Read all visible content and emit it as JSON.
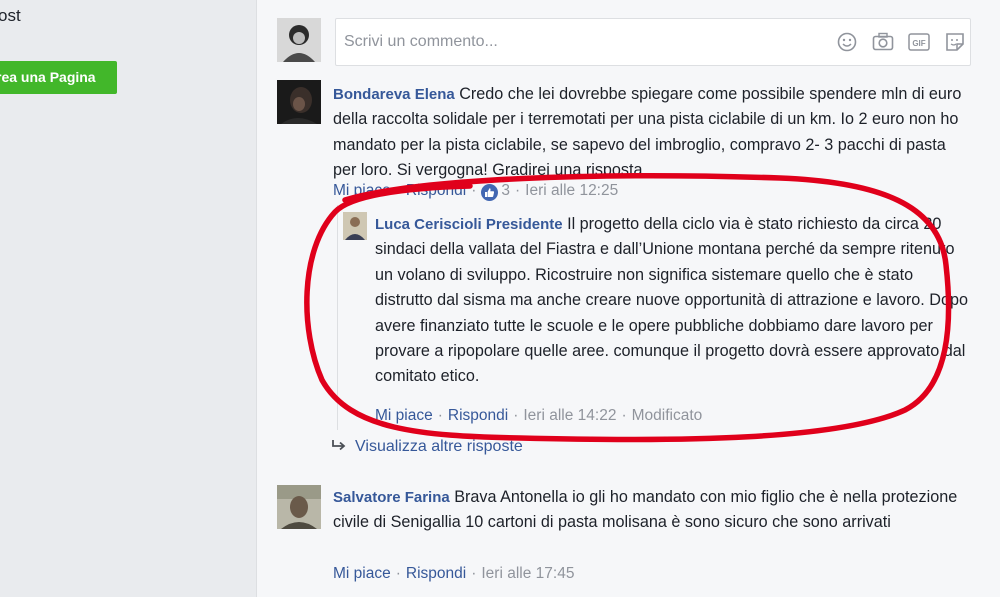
{
  "sidebar": {
    "post_text": "ost",
    "create_page_label": "rea una Pagina"
  },
  "composer": {
    "placeholder": "Scrivi un commento...",
    "icons": [
      "emoji-icon",
      "camera-icon",
      "gif-icon",
      "sticker-icon"
    ]
  },
  "comments": [
    {
      "author": "Bondareva Elena",
      "text": " Credo che lei dovrebbe spiegare come possibile spendere mln di euro della raccolta solidale per i terremotati per una pista ciclabile di un km. Io 2 euro non ho mandato per la pista ciclabile, se sapevo del imbroglio, compravo 2- 3 pacchi di pasta per loro. Si vergogna! Gradirei una risposta",
      "like_label": "Mi piace",
      "reply_label": "Rispondi",
      "reactions": "3",
      "time": "Ieri alle 12:25"
    },
    {
      "author": "Luca Ceriscioli Presidente",
      "text": " Il progetto della ciclo via è stato richiesto da circa 20 sindaci della vallata del Fiastra e dall’Unione montana perché da sempre ritenuto un volano di sviluppo. Ricostruire non significa sistemare quello che è stato distrutto dal sisma ma anche creare nuove opportunità di attrazione e lavoro. Dopo avere finanziato tutte le scuole e le opere pubbliche dobbiamo dare lavoro per provare a ripopolare quelle aree. comunque il progetto dovrà essere approvato dal comitato etico.",
      "like_label": "Mi piace",
      "reply_label": "Rispondi",
      "time": "Ieri alle 14:22",
      "edited": "Modificato"
    },
    {
      "author": "Salvatore Farina",
      "text": " Brava Antonella io gli ho mandato con mio figlio che è nella protezione civile di Senigallia 10 cartoni di pasta molisana è sono sicuro che sono arrivati",
      "like_label": "Mi piace",
      "reply_label": "Rispondi",
      "time": "Ieri alle 17:45"
    }
  ],
  "more_replies_label": "Visualizza altre risposte",
  "colors": {
    "link": "#365899",
    "meta": "#90949c",
    "button_green": "#42b72a",
    "annotation_red": "#e0001b"
  }
}
